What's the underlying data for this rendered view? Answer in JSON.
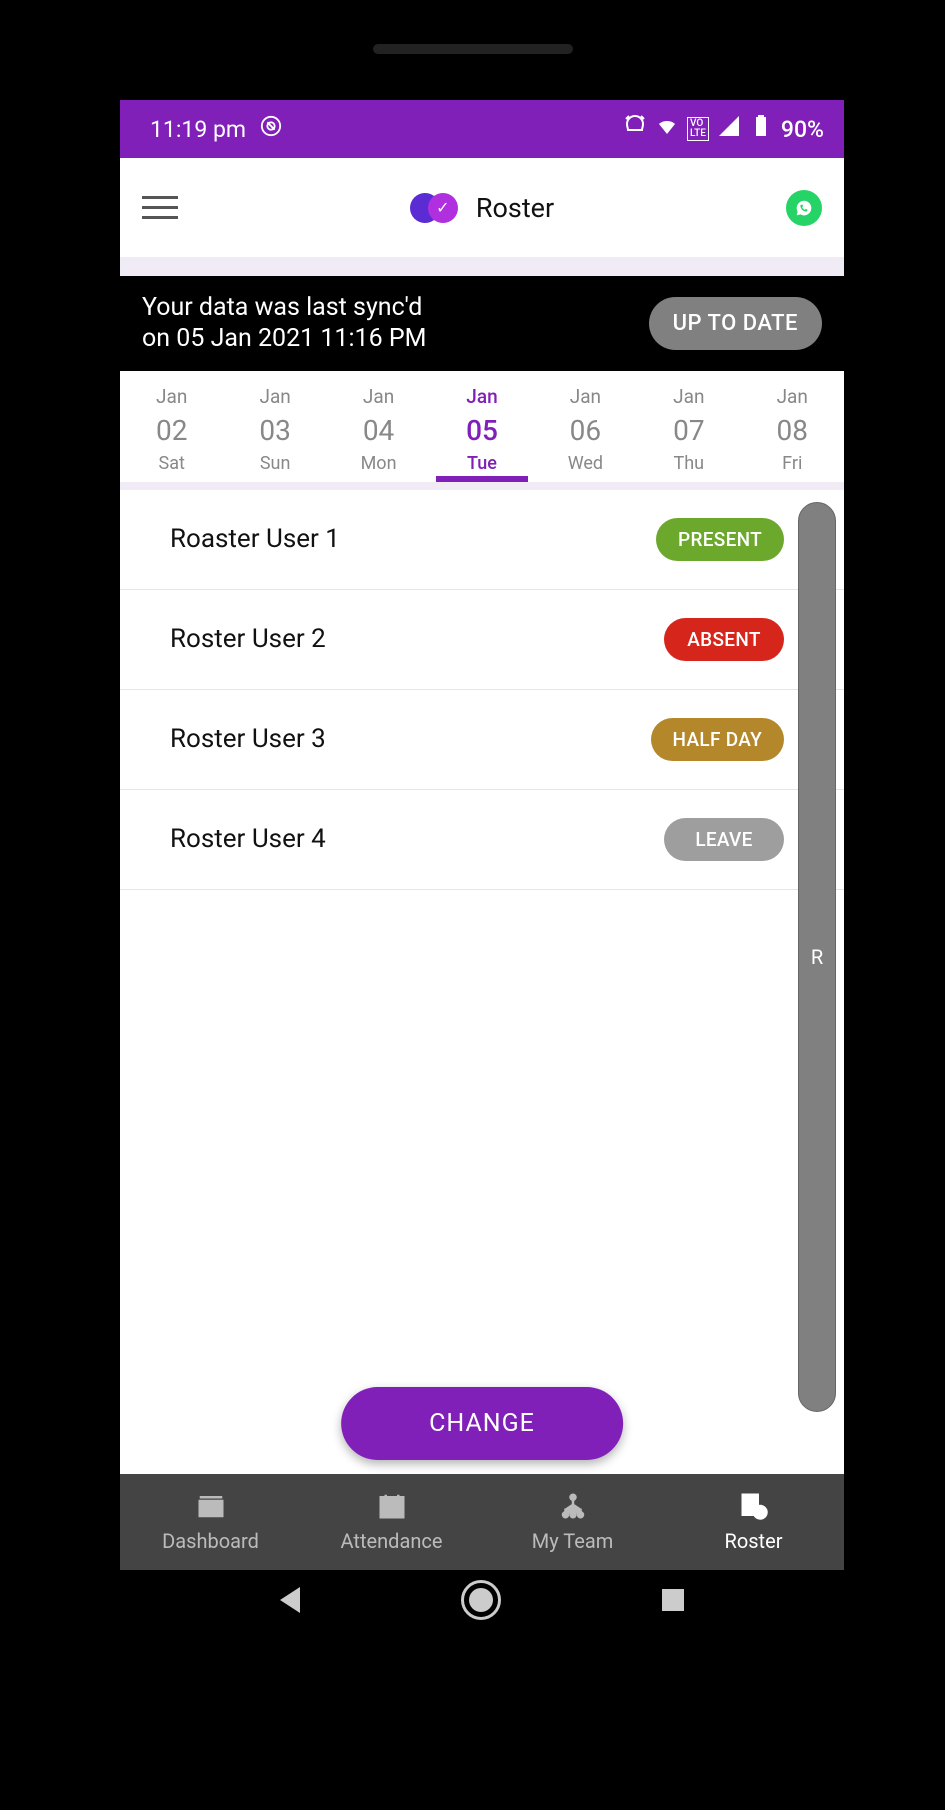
{
  "status": {
    "time": "11:19 pm",
    "battery": "90%"
  },
  "header": {
    "title": "Roster"
  },
  "sync": {
    "line1": "Your data was last sync'd",
    "line2": "on 05 Jan 2021 11:16 PM",
    "button": "UP TO DATE"
  },
  "dates": [
    {
      "month": "Jan",
      "day": "02",
      "dow": "Sat",
      "selected": false
    },
    {
      "month": "Jan",
      "day": "03",
      "dow": "Sun",
      "selected": false
    },
    {
      "month": "Jan",
      "day": "04",
      "dow": "Mon",
      "selected": false
    },
    {
      "month": "Jan",
      "day": "05",
      "dow": "Tue",
      "selected": true
    },
    {
      "month": "Jan",
      "day": "06",
      "dow": "Wed",
      "selected": false
    },
    {
      "month": "Jan",
      "day": "07",
      "dow": "Thu",
      "selected": false
    },
    {
      "month": "Jan",
      "day": "08",
      "dow": "Fri",
      "selected": false
    }
  ],
  "roster": [
    {
      "name": "Roaster User 1",
      "status": "PRESENT",
      "cls": "pill-present"
    },
    {
      "name": "Roster User 2",
      "status": "ABSENT",
      "cls": "pill-absent"
    },
    {
      "name": "Roster User 3",
      "status": "HALF DAY",
      "cls": "pill-halfday"
    },
    {
      "name": "Roster User 4",
      "status": "LEAVE",
      "cls": "pill-leave"
    }
  ],
  "scroll_letter": "R",
  "change_button": "CHANGE",
  "nav": [
    {
      "label": "Dashboard",
      "active": false
    },
    {
      "label": "Attendance",
      "active": false
    },
    {
      "label": "My Team",
      "active": false
    },
    {
      "label": "Roster",
      "active": true
    }
  ]
}
